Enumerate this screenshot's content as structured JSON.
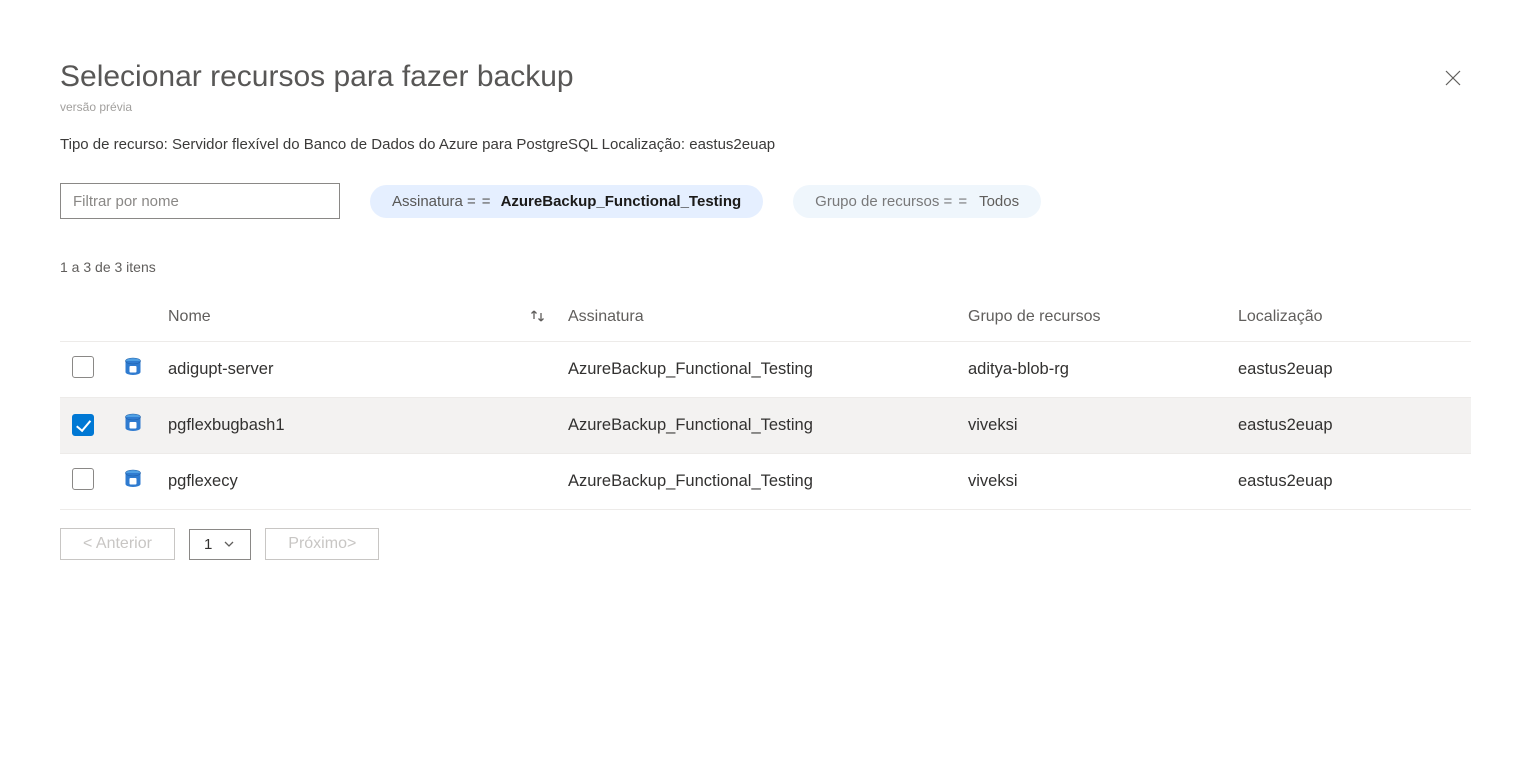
{
  "header": {
    "title": "Selecionar recursos para fazer backup",
    "preview_label": "versão prévia",
    "subtext": "Tipo de recurso: Servidor flexível do Banco de Dados do Azure para PostgreSQL Localização: eastus2euap"
  },
  "filters": {
    "name_placeholder": "Filtrar por nome",
    "subscription_label": "Assinatura =",
    "subscription_eq": "=",
    "subscription_value": "AzureBackup_Functional_Testing",
    "rg_label": "Grupo de recursos =",
    "rg_eq": "=",
    "rg_value": "Todos"
  },
  "list": {
    "count_text": "1 a 3 de 3 itens",
    "columns": {
      "name": "Nome",
      "subscription": "Assinatura",
      "rg": "Grupo de recursos",
      "location": "Localização"
    },
    "rows": [
      {
        "checked": false,
        "name": "adigupt-server",
        "subscription": "AzureBackup_Functional_Testing",
        "rg": "aditya-blob-rg",
        "location": "eastus2euap"
      },
      {
        "checked": true,
        "name": "pgflexbugbash1",
        "subscription": "AzureBackup_Functional_Testing",
        "rg": "viveksi",
        "location": "eastus2euap"
      },
      {
        "checked": false,
        "name": "pgflexecy",
        "subscription": "AzureBackup_Functional_Testing",
        "rg": "viveksi",
        "location": "eastus2euap"
      }
    ]
  },
  "pager": {
    "prev": "<  Anterior",
    "page": "1",
    "next": "Próximo>"
  }
}
